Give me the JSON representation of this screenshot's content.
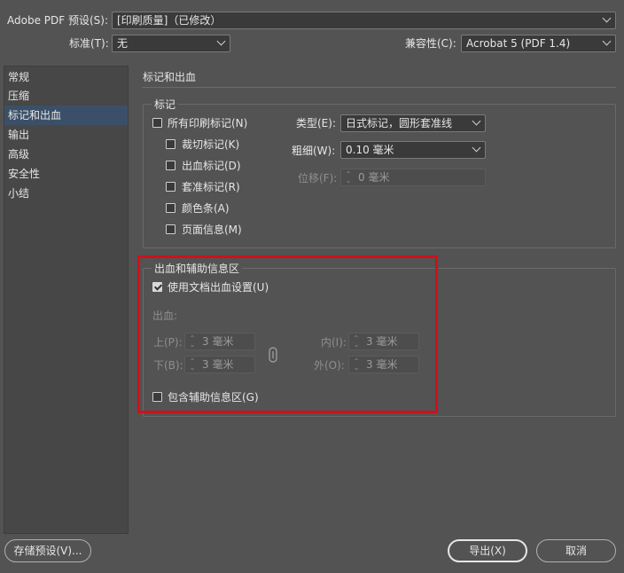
{
  "header": {
    "preset_label": "Adobe PDF 预设(S):",
    "preset_value": "[印刷质量]（已修改）",
    "standard_label": "标准(T):",
    "standard_value": "无",
    "compat_label": "兼容性(C):",
    "compat_value": "Acrobat 5 (PDF 1.4)"
  },
  "sidebar": {
    "items": [
      {
        "label": "常规",
        "selected": false
      },
      {
        "label": "压缩",
        "selected": false
      },
      {
        "label": "标记和出血",
        "selected": true
      },
      {
        "label": "输出",
        "selected": false
      },
      {
        "label": "高级",
        "selected": false
      },
      {
        "label": "安全性",
        "selected": false
      },
      {
        "label": "小结",
        "selected": false
      }
    ]
  },
  "main": {
    "section_title": "标记和出血",
    "marks": {
      "group_title": "标记",
      "all_marks": {
        "label": "所有印刷标记(N)",
        "checked": false
      },
      "crop": {
        "label": "裁切标记(K)",
        "checked": false
      },
      "bleed": {
        "label": "出血标记(D)",
        "checked": false
      },
      "registration": {
        "label": "套准标记(R)",
        "checked": false
      },
      "color_bars": {
        "label": "颜色条(A)",
        "checked": false
      },
      "page_info": {
        "label": "页面信息(M)",
        "checked": false
      },
      "type_label": "类型(E):",
      "type_value": "日式标记，圆形套准线",
      "weight_label": "粗细(W):",
      "weight_value": "0.10 毫米",
      "offset_label": "位移(F):",
      "offset_value": "0 毫米"
    },
    "bleed": {
      "group_title": "出血和辅助信息区",
      "use_doc": {
        "label": "使用文档出血设置(U)",
        "checked": true
      },
      "bleed_label": "出血:",
      "top_label": "上(P):",
      "top_value": "3 毫米",
      "bottom_label": "下(B):",
      "bottom_value": "3 毫米",
      "inside_label": "内(I):",
      "inside_value": "3 毫米",
      "outside_label": "外(O):",
      "outside_value": "3 毫米",
      "include_slug": {
        "label": "包含辅助信息区(G)",
        "checked": false
      }
    }
  },
  "footer": {
    "save_preset": "存储预设(V)...",
    "export": "导出(X)",
    "cancel": "取消"
  },
  "colors": {
    "background": "#535353",
    "selection": "#3b5068",
    "highlight_box": "#d0101a"
  }
}
